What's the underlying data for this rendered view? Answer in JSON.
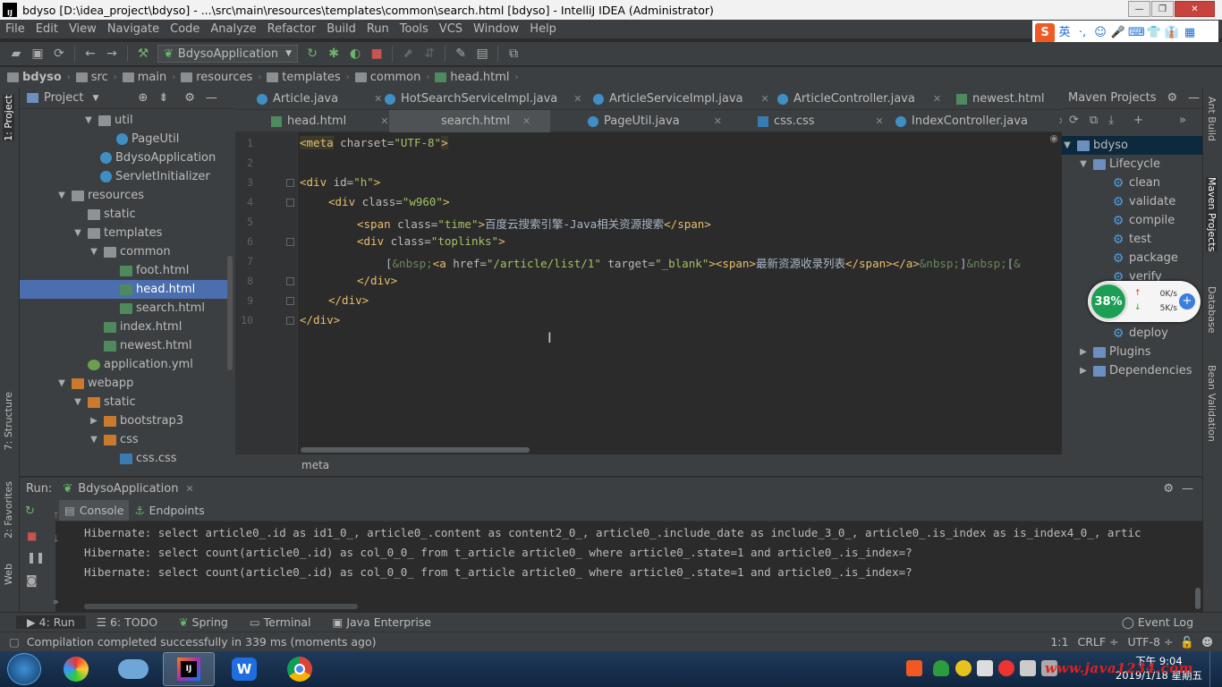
{
  "window": {
    "title": "bdyso [D:\\idea_project\\bdyso] - ...\\src\\main\\resources\\templates\\common\\search.html [bdyso] - IntelliJ IDEA (Administrator)",
    "minimize": "—",
    "restore": "❐",
    "close": "✕"
  },
  "menu": [
    "File",
    "Edit",
    "View",
    "Navigate",
    "Code",
    "Analyze",
    "Refactor",
    "Build",
    "Run",
    "Tools",
    "VCS",
    "Window",
    "Help"
  ],
  "ime": [
    "S",
    "英",
    "·,",
    "☺",
    "🎤",
    "⌨",
    "👕",
    "👔",
    "▦"
  ],
  "toolbar": {
    "run_config": "BdysoApplication"
  },
  "breadcrumbs": [
    "bdyso",
    "src",
    "main",
    "resources",
    "templates",
    "common",
    "head.html"
  ],
  "project_panel": {
    "title": "Project",
    "rows": [
      {
        "label": "util",
        "type": "folder",
        "expanded": true
      },
      {
        "label": "PageUtil",
        "type": "class"
      },
      {
        "label": "BdysoApplication",
        "type": "class"
      },
      {
        "label": "ServletInitializer",
        "type": "class"
      },
      {
        "label": "resources",
        "type": "folder",
        "expanded": true
      },
      {
        "label": "static",
        "type": "folder"
      },
      {
        "label": "templates",
        "type": "folder",
        "expanded": true
      },
      {
        "label": "common",
        "type": "folder",
        "expanded": true
      },
      {
        "label": "foot.html",
        "type": "html"
      },
      {
        "label": "head.html",
        "type": "html",
        "selected": true
      },
      {
        "label": "search.html",
        "type": "html"
      },
      {
        "label": "index.html",
        "type": "html"
      },
      {
        "label": "newest.html",
        "type": "html"
      },
      {
        "label": "application.yml",
        "type": "yml"
      },
      {
        "label": "webapp",
        "type": "orange",
        "expanded": true
      },
      {
        "label": "static",
        "type": "orange",
        "expanded": true
      },
      {
        "label": "bootstrap3",
        "type": "orange",
        "expanded": false
      },
      {
        "label": "css",
        "type": "orange",
        "expanded": true
      },
      {
        "label": "css.css",
        "type": "css"
      }
    ]
  },
  "editor_tabs_row1": [
    {
      "label": "Article.java",
      "icon": "class"
    },
    {
      "label": "HotSearchServiceImpl.java",
      "icon": "class"
    },
    {
      "label": "ArticleServiceImpl.java",
      "icon": "class"
    },
    {
      "label": "ArticleController.java",
      "icon": "class"
    },
    {
      "label": "newest.html",
      "icon": "html"
    }
  ],
  "editor_tabs_row2": [
    {
      "label": "head.html",
      "icon": "html"
    },
    {
      "label": "search.html",
      "icon": "html",
      "active": true
    },
    {
      "label": "PageUtil.java",
      "icon": "class"
    },
    {
      "label": "css.css",
      "icon": "css"
    },
    {
      "label": "IndexController.java",
      "icon": "class"
    }
  ],
  "code": {
    "line_numbers": [
      "1",
      "2",
      "3",
      "4",
      "5",
      "6",
      "7",
      "8",
      "9",
      "10"
    ],
    "l1_tag": "<meta",
    "l1_attr": " charset=",
    "l1_val": "\"UTF-8\"",
    "l1_end": ">",
    "l3_tag": "<div",
    "l3_attr": " id=",
    "l3_val": "\"h\"",
    "l3_end": ">",
    "l4_tag": "<div",
    "l4_attr": " class=",
    "l4_val": "\"w960\"",
    "l4_end": ">",
    "l5_tag": "<span",
    "l5_attr": " class=",
    "l5_val": "\"time\"",
    "l5_end": ">",
    "l5_text": "百度云搜索引擎-Java相关资源搜索",
    "l5_close": "</span>",
    "l6_tag": "<div",
    "l6_attr": " class=",
    "l6_val": "\"toplinks\"",
    "l6_end": ">",
    "l7_a": "[",
    "l7_b": "&nbsp;",
    "l7_c": "<a",
    "l7_d": " href=",
    "l7_e": "\"/article/list/1\"",
    "l7_f": " target=",
    "l7_g": "\"_blank\"",
    "l7_h": "><span>",
    "l7_i": "最新资源收录列表",
    "l7_j": "</span></a>",
    "l7_k": "&nbsp;",
    "l7_l": "]",
    "l7_m": "&nbsp;",
    "l7_n": "[",
    "l7_o": "&",
    "l8": "</div>",
    "l9": "</div>",
    "l10": "</div>"
  },
  "editor_status": "meta",
  "maven": {
    "title": "Maven Projects",
    "project": "bdyso",
    "lifecycle": "Lifecycle",
    "goals": [
      "clean",
      "validate",
      "compile",
      "test",
      "package",
      "verify"
    ],
    "deploy": "deploy",
    "plugins": "Plugins",
    "dependencies": "Dependencies"
  },
  "net_widget": {
    "percent": "38%",
    "up": "0K/s",
    "down": "5K/s"
  },
  "left_strip": [
    "1: Project",
    "7: Structure",
    "2: Favorites",
    "Web"
  ],
  "right_strip": [
    "Ant Build",
    "Maven Projects",
    "Database",
    "Bean Validation"
  ],
  "run": {
    "label": "Run:",
    "config": "BdysoApplication",
    "tabs": [
      "Console",
      "Endpoints"
    ],
    "lines": [
      "Hibernate: select article0_.id as id1_0_, article0_.content as content2_0_, article0_.include_date as include_3_0_, article0_.is_index as is_index4_0_, artic",
      "Hibernate: select count(article0_.id) as col_0_0_ from t_article article0_ where article0_.state=1 and article0_.is_index=?",
      "Hibernate: select count(article0_.id) as col_0_0_ from t_article article0_ where article0_.state=1 and article0_.is_index=?"
    ]
  },
  "tool_windows": [
    {
      "label": "4: Run",
      "icon": "▶"
    },
    {
      "label": "6: TODO",
      "icon": "☰"
    },
    {
      "label": "Spring",
      "icon": "❦"
    },
    {
      "label": "Terminal",
      "icon": "▭"
    },
    {
      "label": "Java Enterprise",
      "icon": "▣"
    }
  ],
  "event_log": "Event Log",
  "status": {
    "message": "Compilation completed successfully in 339 ms (moments ago)",
    "position": "1:1",
    "line_sep": "CRLF ÷",
    "encoding": "UTF-8 ÷"
  },
  "clock": {
    "time": "下午 9:04",
    "date": "2019/1/18 星期五"
  },
  "watermark": "www.java1234.com"
}
